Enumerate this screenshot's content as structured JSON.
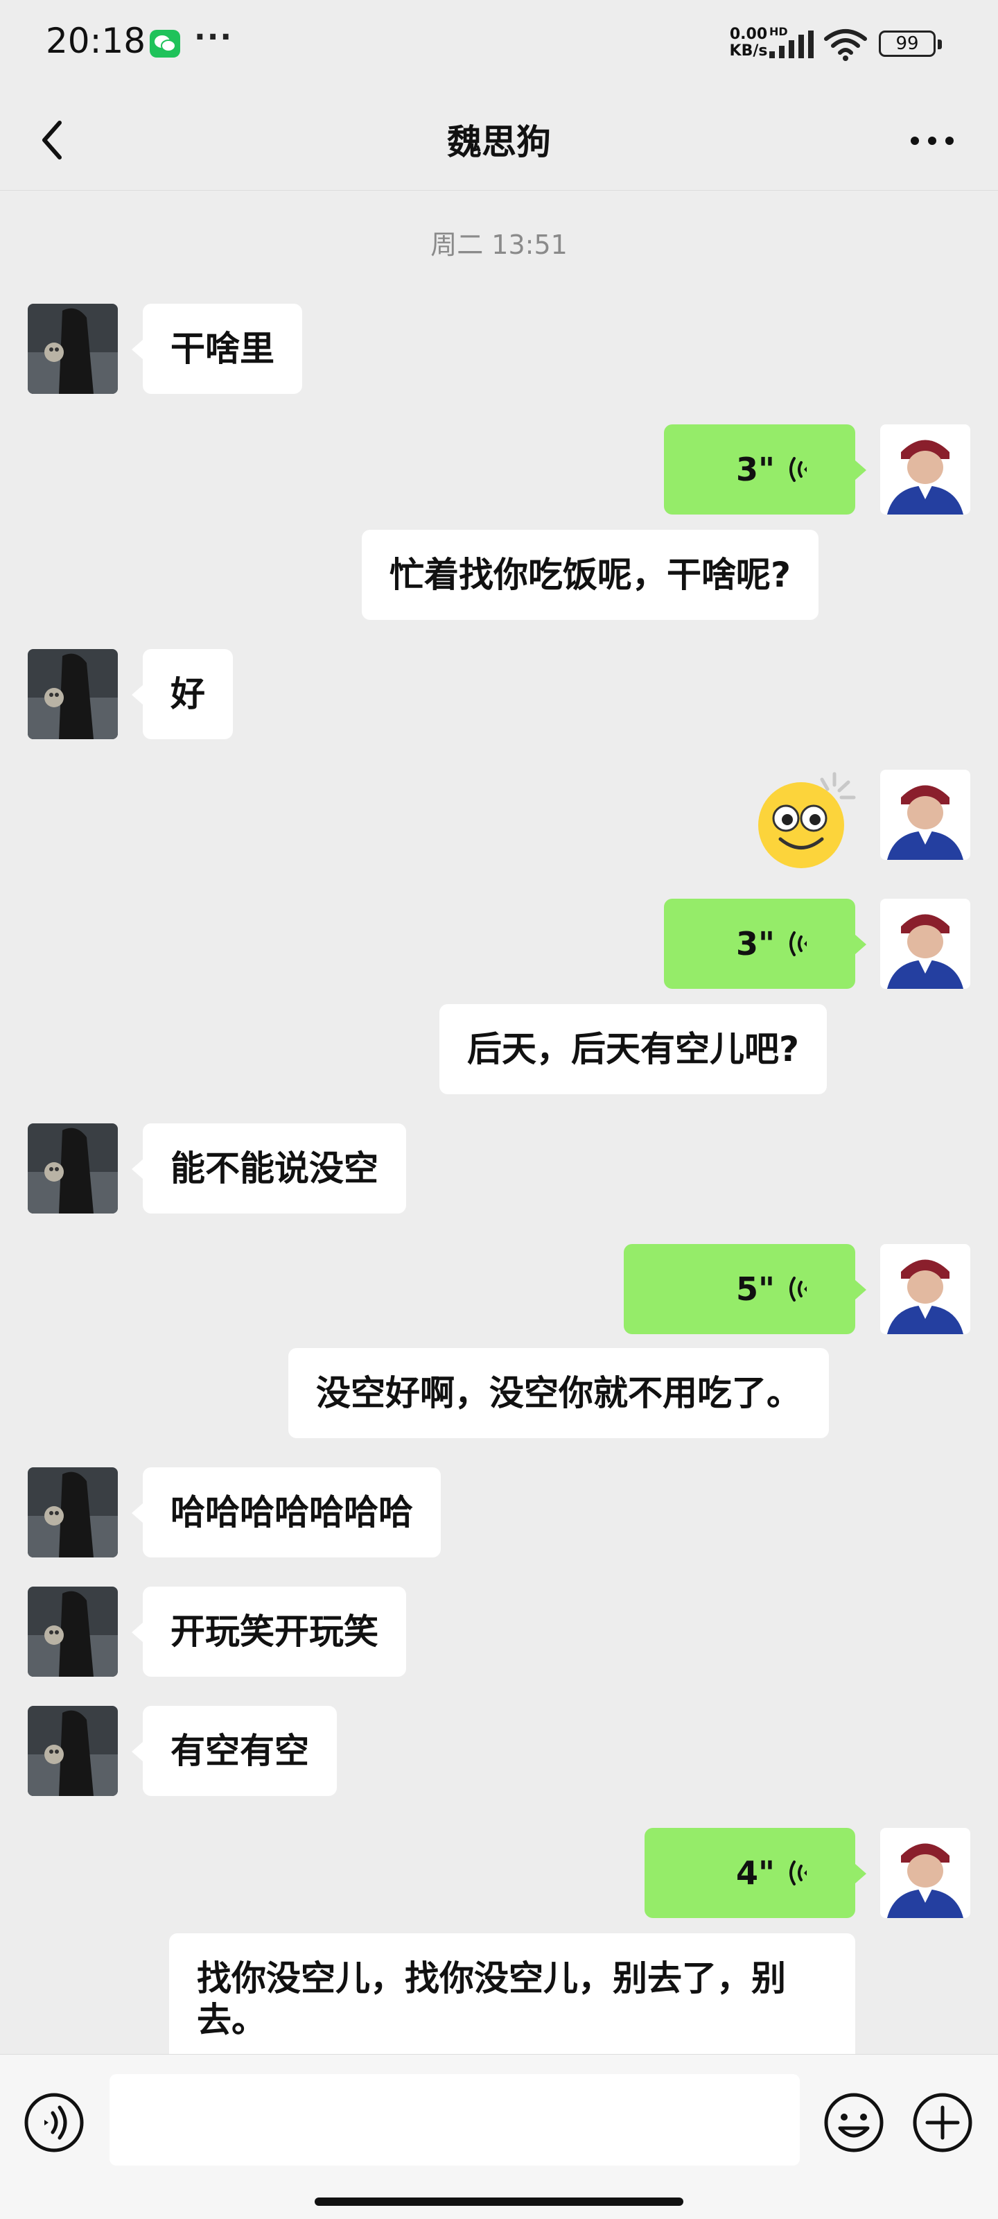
{
  "status_bar": {
    "time": "20:18",
    "network_speed": "0.00\nKB/s",
    "network_type": "HD",
    "battery": "99",
    "icons": [
      "wechat-notification-icon",
      "more-notifications-icon",
      "signal-icon",
      "wifi-icon",
      "battery-icon"
    ]
  },
  "header": {
    "title": "魏思狗",
    "back_icon": "chevron-left-icon",
    "more_icon": "more-horizontal-icon"
  },
  "chat": {
    "timestamp": "周二 13:51",
    "messages": [
      {
        "sender": "contact",
        "type": "text",
        "text": "干啥里"
      },
      {
        "sender": "me",
        "type": "voice",
        "duration": "3\""
      },
      {
        "sender": "me",
        "type": "transcript",
        "text": "忙着找你吃饭呢，干啥呢?"
      },
      {
        "sender": "contact",
        "type": "text",
        "text": "好"
      },
      {
        "sender": "me",
        "type": "sticker",
        "icon": "dizzy-smile-emoji"
      },
      {
        "sender": "me",
        "type": "voice",
        "duration": "3\""
      },
      {
        "sender": "me",
        "type": "transcript",
        "text": "后天，后天有空儿吧?"
      },
      {
        "sender": "contact",
        "type": "text",
        "text": "能不能说没空"
      },
      {
        "sender": "me",
        "type": "voice",
        "duration": "5\""
      },
      {
        "sender": "me",
        "type": "transcript",
        "text": "没空好啊，没空你就不用吃了。"
      },
      {
        "sender": "contact",
        "type": "text",
        "text": "哈哈哈哈哈哈哈"
      },
      {
        "sender": "contact",
        "type": "text",
        "text": "开玩笑开玩笑"
      },
      {
        "sender": "contact",
        "type": "text",
        "text": "有空有空"
      },
      {
        "sender": "me",
        "type": "voice",
        "duration": "4\""
      },
      {
        "sender": "me",
        "type": "transcript",
        "text": "找你没空儿，找你没空儿，别去了，别去。"
      }
    ]
  },
  "input_bar": {
    "placeholder": "",
    "icons": [
      "voice-input-icon",
      "emoji-icon",
      "plus-icon"
    ]
  },
  "colors": {
    "background": "#ededed",
    "my_bubble": "#95ec69",
    "their_bubble": "#ffffff",
    "wechat_green": "#1fc25a"
  }
}
